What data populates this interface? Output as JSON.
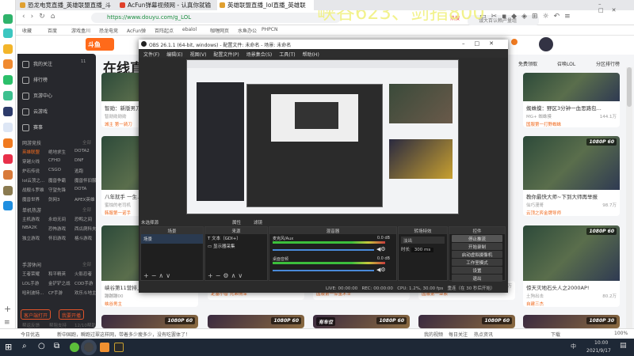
{
  "watermark": "峡谷623、剑指800",
  "browser": {
    "tabs": [
      {
        "label": "恐龙电竞直播_英雄联盟直播_斗"
      },
      {
        "label": "AcFun弹幕视频网 - 认真你就输"
      },
      {
        "label": "英雄联盟直播_lol直播_英雄联"
      }
    ],
    "url": "https://www.douyu.com/g_LOL",
    "search_placeholder": "饿大百认赖产量组",
    "hot_label": "热搜",
    "bookmarks": [
      "收藏",
      "百度",
      "游戏盒川",
      "恐龙电竞",
      "AcFun弹",
      "百阵起点",
      "ebalol",
      "咖喱网页",
      "水鱼办公",
      "PHPCN"
    ]
  },
  "douyu": {
    "logo": "斗鱼",
    "page_title": "在线直播",
    "nav": {
      "items": [
        "我的关注",
        "排行榜",
        "页游中心",
        "云游戏",
        "赛事"
      ],
      "follow_count": "11",
      "sections": [
        {
          "title": "网游竞技",
          "more": "全部",
          "games": [
            "英雄联盟",
            "绝地求生",
            "DOTA2",
            "穿越火线",
            "CFHD",
            "DNF",
            "炉石传说",
            "CSGO",
            "逃跑",
            "lol云顶之...",
            "魔兽争霸",
            "魔兽怀旧服",
            "战舰斗罗维",
            "守望先锋",
            "DOTA",
            "魔兽世界",
            "剑网3",
            "APEX英雄"
          ]
        },
        {
          "title": "单机热游",
          "more": "全部",
          "games": [
            "主机游戏",
            "永劫无间",
            "恐鸭之间",
            "NBA2K",
            "恐怖游戏",
            "西瓜爬科夫",
            "独立游戏",
            "怀旧游戏",
            "格斗游戏"
          ]
        },
        {
          "title": "手游休闲",
          "more": "全部",
          "games": [
            "王者荣耀",
            "和平精英",
            "火影忍者",
            "LOL手游",
            "金铲铲之战",
            "COD手游",
            "哈利波特...",
            "CF手游",
            "欢乐斗地主"
          ]
        }
      ],
      "btn_client": "客户端打开",
      "btn_live": "我要开播",
      "footer": [
        "帮返反馈",
        "帮阻支持",
        "12/10帮助"
      ]
    },
    "right_tools": [
      "免费领取",
      "召唤LOL",
      "分区排行榜"
    ],
    "cards": [
      {
        "title": "智勋：新版男刀...",
        "author": "智勋勋勋勋",
        "badge": "城主 第一骑刀",
        "res": ""
      },
      {
        "title": "蜘蛛摸：野区3分钟一血思路包...",
        "tag": "英雄联盟",
        "author": "MG+ 蜘蛛摸",
        "views": "144.1万",
        "badge": "国服第一打野蜘蛛",
        "res": ""
      },
      {
        "title": "八年就手 一生...",
        "author": "蜜烛的老司机",
        "badge": "韩服第一诺手",
        "res": ""
      },
      {
        "title": "教你最快大师~下到大师再举报",
        "tag": "英雄联盟",
        "author": "仙巧漫哥",
        "views": "98.7万",
        "badge": "云顶之弈金牌导师",
        "res": "1080P 60"
      },
      {
        "title": "峡谷第11营排上...",
        "author": "蹦蹦蹦00",
        "badge": "峡谷男主",
        "res": ""
      },
      {
        "title": "惊天灭地石头人之2000AP!",
        "tag": "英雄联盟",
        "author": "土狗出击",
        "views": "80.2万",
        "badge": "自建三杰",
        "res": "1080P 60"
      },
      {
        "author2": "美琳今思思",
        "views": "95.6万",
        "badge": "定塞小智 兄弟情深"
      },
      {
        "author2": "阿萨的曲",
        "views": "81.7万",
        "badge": "国服第一惊金术士"
      },
      {
        "author2": "Night - 刷钢兄",
        "views": "40.7万",
        "badge": "国服第一亚索"
      }
    ],
    "row4_res": [
      "1080P 60",
      "1080P 60",
      "1080P 60",
      "1080P 60",
      "1080P 30"
    ],
    "row4_badge": "有车位"
  },
  "obs": {
    "title": "OBS 26.1.1 (64-bit, windows) - 配置文件: 未命名 - 场景: 未命名",
    "menu": [
      "文件(F)",
      "编辑(E)",
      "视图(V)",
      "配置文件(P)",
      "场景集合(S)",
      "工具(T)",
      "帮助(H)"
    ],
    "no_source": "未选择源",
    "props": "属性",
    "filters": "滤镜",
    "docks": {
      "scenes": "场景",
      "sources": "来源",
      "mixer": "混音器",
      "transitions": "转场特效",
      "controls": "控件"
    },
    "scene_items": [
      "场景"
    ],
    "source_items": [
      "文本（GDI+）",
      "显示器采集"
    ],
    "mixer": [
      {
        "name": "麦克风/Aux",
        "db": "0.0 dB"
      },
      {
        "name": "桌面音频",
        "db": "0.0 dB"
      }
    ],
    "transition": "淡出",
    "duration_label": "时长",
    "duration": "300 ms",
    "controls": [
      "停止推流",
      "开始录制",
      "启动虚拟摄像机",
      "工作室模式",
      "设置",
      "退出"
    ],
    "status": {
      "live": "LIVE: 00:00:00",
      "rec": "REC: 00:00:00",
      "cpu": "CPU: 1.2%, 30.00 fps",
      "reconnect": "重连（在 30 秒后开始）"
    }
  },
  "statusbar": {
    "left": "今日优选",
    "news": "新中国跑，瞬跑过翠这样网，带着多少瘦多少，没有吃罢体了！",
    "items": [
      "我的视频",
      "每日关注",
      "热点资讯",
      "下载",
      "100%"
    ]
  },
  "taskbar": {
    "time": "10:00",
    "date": "2021/9/17",
    "ime": "中"
  }
}
